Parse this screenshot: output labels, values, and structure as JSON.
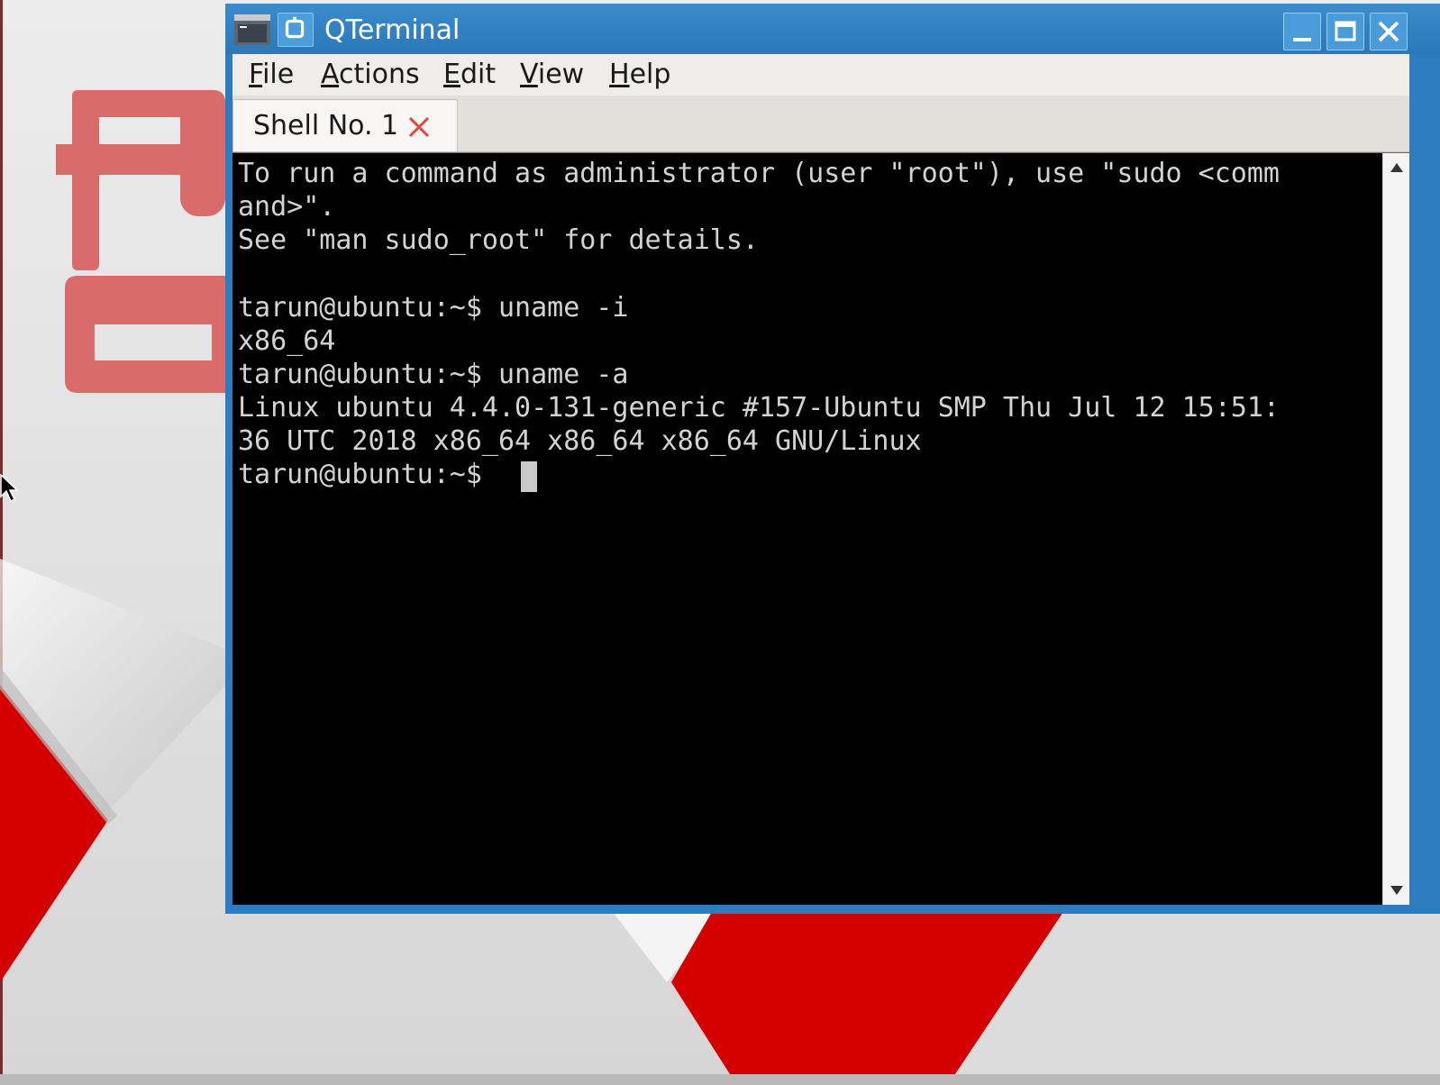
{
  "window": {
    "title": "QTerminal"
  },
  "menubar": {
    "items": [
      {
        "label": "File",
        "mnemonic": "F",
        "rest": "ile"
      },
      {
        "label": "Actions",
        "mnemonic": "A",
        "rest": "ctions"
      },
      {
        "label": "Edit",
        "mnemonic": "E",
        "rest": "dit"
      },
      {
        "label": "View",
        "mnemonic": "V",
        "rest": "iew"
      },
      {
        "label": "Help",
        "mnemonic": "H",
        "rest": "elp"
      }
    ]
  },
  "tabs": [
    {
      "label": "Shell No. 1",
      "active": true,
      "close_icon": "close-x-icon"
    }
  ],
  "terminal": {
    "lines": [
      "To run a command as administrator (user \"root\"), use \"sudo <comm",
      "and>\".",
      "See \"man sudo_root\" for details.",
      "",
      "tarun@ubuntu:~$ uname -i",
      "x86_64",
      "tarun@ubuntu:~$ uname -a",
      "Linux ubuntu 4.4.0-131-generic #157-Ubuntu SMP Thu Jul 12 15:51:",
      "36 UTC 2018 x86_64 x86_64 x86_64 GNU/Linux",
      "tarun@ubuntu:~$ "
    ]
  },
  "icons": {
    "app": "terminal-app-icon",
    "pin": "pin-window-icon",
    "minimize": "minimize-icon",
    "maximize": "maximize-icon",
    "close": "close-icon",
    "scroll_up": "arrow-up-icon",
    "scroll_down": "arrow-down-icon",
    "mouse": "mouse-pointer-icon"
  },
  "colors": {
    "titlebar": "#2d7cbf",
    "terminal_bg": "#000000",
    "terminal_fg": "#d3d3d3",
    "tab_close": "#e0483a",
    "wallpaper_red": "#d40000",
    "wallpaper_pink": "#d96b6b"
  }
}
